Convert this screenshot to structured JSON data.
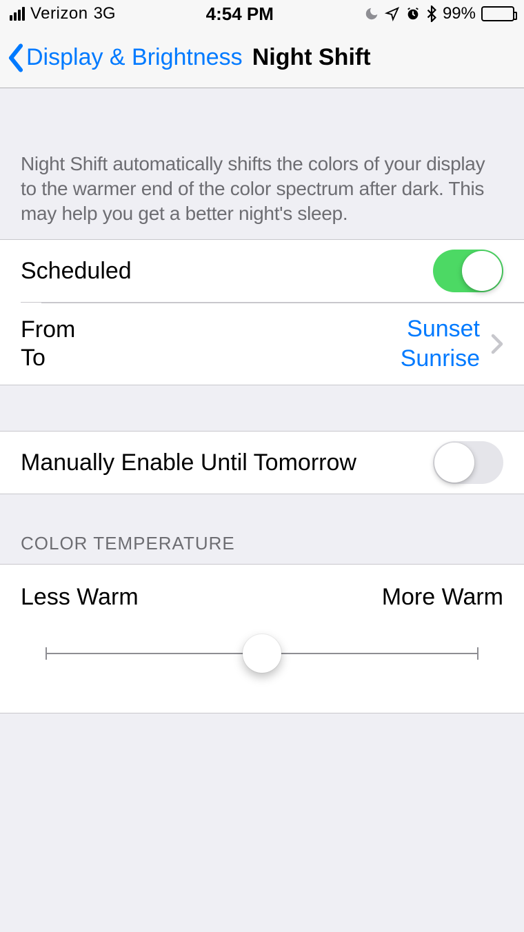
{
  "status": {
    "carrier": "Verizon",
    "network": "3G",
    "time": "4:54 PM",
    "battery_percent": "99%"
  },
  "nav": {
    "back_label": "Display & Brightness",
    "title": "Night Shift"
  },
  "description": "Night Shift automatically shifts the colors of your display to the warmer end of the color spectrum after dark. This may help you get a better night's sleep.",
  "scheduled": {
    "label": "Scheduled",
    "on": true,
    "from_label": "From",
    "to_label": "To",
    "from_value": "Sunset",
    "to_value": "Sunrise"
  },
  "manual": {
    "label": "Manually Enable Until Tomorrow",
    "on": false
  },
  "color_temp": {
    "header": "COLOR TEMPERATURE",
    "left_label": "Less Warm",
    "right_label": "More Warm",
    "value_percent": 50
  }
}
